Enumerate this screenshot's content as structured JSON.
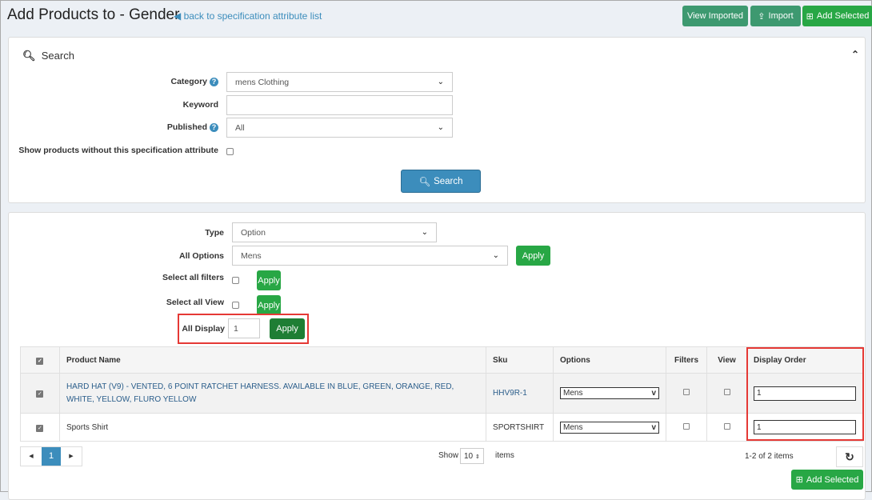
{
  "header": {
    "title": "Add Products to - Gender",
    "back_link": "back to specification attribute list",
    "view_imported": "View Imported",
    "import": "Import",
    "add_selected": "Add Selected"
  },
  "search": {
    "title": "Search",
    "category_label": "Category",
    "category_value": "mens Clothing",
    "keyword_label": "Keyword",
    "keyword_value": "",
    "published_label": "Published",
    "published_value": "All",
    "show_without_label": "Show products without this specification attribute",
    "search_button": "Search"
  },
  "bulk": {
    "type_label": "Type",
    "type_value": "Option",
    "all_options_label": "All Options",
    "all_options_value": "Mens",
    "select_filters_label": "Select all filters",
    "select_view_label": "Select all View",
    "all_display_label": "All Display",
    "all_display_value": "1",
    "apply": "Apply"
  },
  "table": {
    "columns": [
      "Product Name",
      "Sku",
      "Options",
      "Filters",
      "View",
      "Display Order"
    ],
    "rows": [
      {
        "name": "HARD HAT (V9) - VENTED, 6 POINT RATCHET HARNESS. AVAILABLE IN BLUE, GREEN, ORANGE, RED, WHITE, YELLOW, FLURO YELLOW",
        "sku": "HHV9R-1",
        "option": "Mens",
        "display_order": "1"
      },
      {
        "name": "Sports Shirt",
        "sku": "SPORTSHIRT",
        "option": "Mens",
        "display_order": "1"
      }
    ]
  },
  "pager": {
    "page": "1",
    "show": "Show",
    "page_size": "10",
    "items": "items",
    "summary": "1-2 of 2 items"
  },
  "footer": {
    "add_selected": "Add Selected"
  },
  "colors": {
    "accent": "#3c8dbc",
    "green": "#28a745",
    "teal": "#3d9970",
    "highlight": "#e53935"
  }
}
